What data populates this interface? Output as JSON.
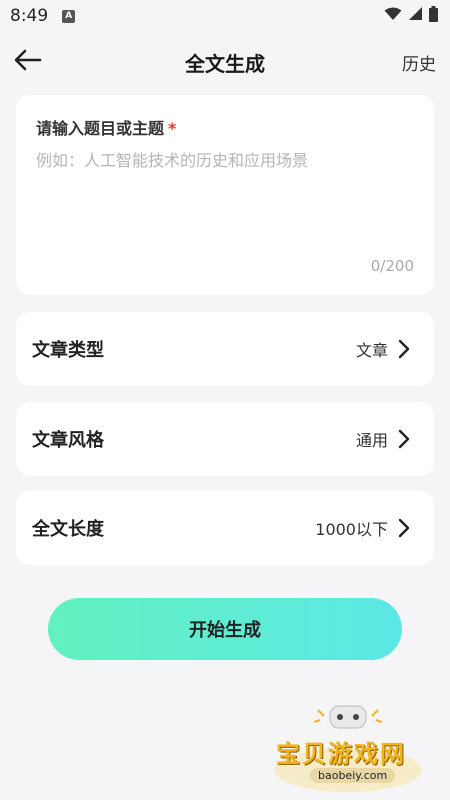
{
  "status_bar": {
    "time": "8:49",
    "notification_icon_letter": "A"
  },
  "header": {
    "title": "全文生成",
    "history_label": "历史"
  },
  "topic": {
    "label": "请输入题目或主题",
    "required_mark": "*",
    "placeholder": "例如：人工智能技术的历史和应用场景",
    "value": "",
    "char_count": "0/200"
  },
  "options": {
    "article_type": {
      "label": "文章类型",
      "value": "文章"
    },
    "article_style": {
      "label": "文章风格",
      "value": "通用"
    },
    "length": {
      "label": "全文长度",
      "value": "1000以下"
    }
  },
  "actions": {
    "start_label": "开始生成"
  },
  "watermark": {
    "brand": "宝贝游戏网",
    "url": "baobeiy.com"
  },
  "colors": {
    "accent_gradient_start": "#62f1bf",
    "accent_gradient_end": "#5ce8e6",
    "required": "#e53935"
  },
  "icons": {
    "back": "arrow-left-icon",
    "chevron": "chevron-right-icon",
    "wifi": "wifi-icon",
    "signal": "signal-icon",
    "battery": "battery-icon"
  }
}
